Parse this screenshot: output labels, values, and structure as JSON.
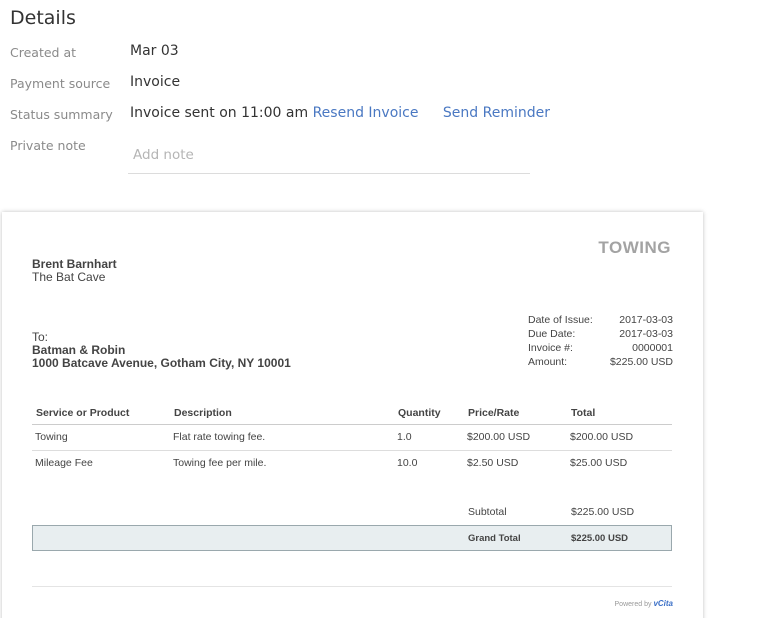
{
  "details": {
    "title": "Details",
    "created_label": "Created at",
    "created_value": "Mar 03",
    "payment_label": "Payment source",
    "payment_value": "Invoice",
    "status_label": "Status summary",
    "status_value": "Invoice sent on 11:00 am",
    "resend_link": "Resend Invoice",
    "reminder_link": "Send Reminder",
    "note_label": "Private note",
    "note_placeholder": "Add note"
  },
  "invoice": {
    "brand": "TOWING",
    "business_name": "Brent Barnhart",
    "business_address": "The Bat Cave",
    "to_label": "To:",
    "client_name": "Batman & Robin",
    "client_address": "1000 Batcave Avenue, Gotham City, NY 10001",
    "meta": [
      {
        "label": "Date of Issue:",
        "value": "2017-03-03"
      },
      {
        "label": "Due Date:",
        "value": "2017-03-03"
      },
      {
        "label": "Invoice #:",
        "value": "0000001"
      },
      {
        "label": "Amount:",
        "value": "$225.00 USD"
      }
    ],
    "columns": [
      "Service or Product",
      "Description",
      "Quantity",
      "Price/Rate",
      "Total"
    ],
    "items": [
      {
        "service": "Towing",
        "description": "Flat rate towing fee.",
        "quantity": "1.0",
        "price": "$200.00 USD",
        "total": "$200.00 USD"
      },
      {
        "service": "Mileage Fee",
        "description": "Towing fee per mile.",
        "quantity": "10.0",
        "price": "$2.50 USD",
        "total": "$25.00 USD"
      }
    ],
    "subtotal_label": "Subtotal",
    "subtotal_value": "$225.00 USD",
    "grand_label": "Grand Total",
    "grand_value": "$225.00 USD",
    "powered_by": "Powered by",
    "powered_brand": "vCita"
  }
}
